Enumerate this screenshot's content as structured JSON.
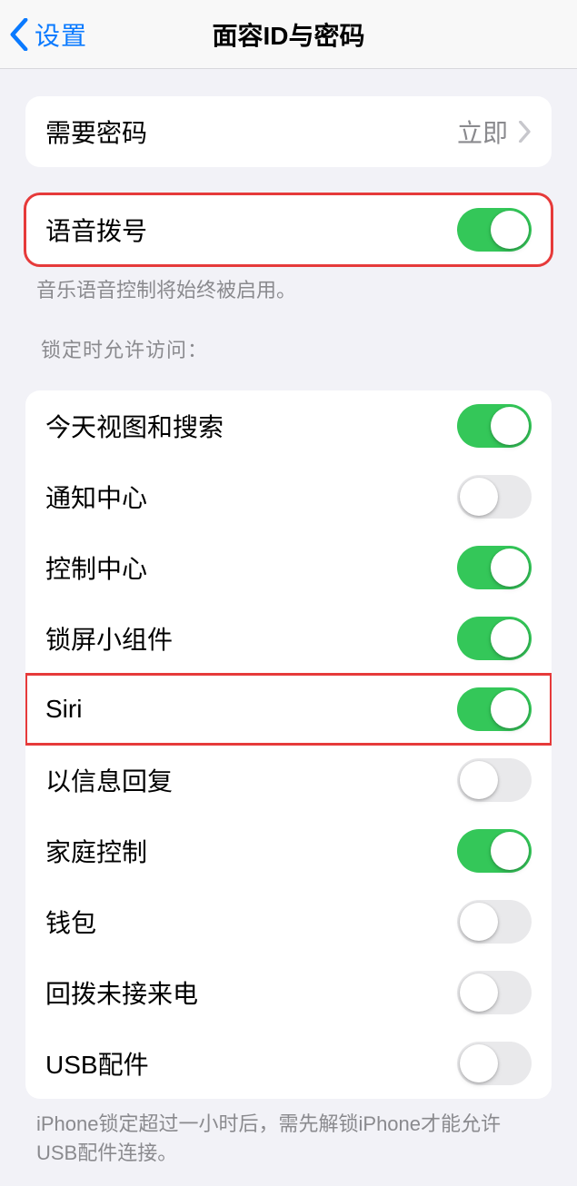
{
  "nav": {
    "back_label": "设置",
    "title": "面容ID与密码"
  },
  "require_passcode": {
    "label": "需要密码",
    "value": "立即"
  },
  "voice_dial": {
    "label": "语音拨号",
    "enabled": true,
    "footer": "音乐语音控制将始终被启用。"
  },
  "lock_section": {
    "header": "锁定时允许访问：",
    "items": [
      {
        "key": "today",
        "label": "今天视图和搜索",
        "enabled": true,
        "highlight": false
      },
      {
        "key": "notification",
        "label": "通知中心",
        "enabled": false,
        "highlight": false
      },
      {
        "key": "control",
        "label": "控制中心",
        "enabled": true,
        "highlight": false
      },
      {
        "key": "widgets",
        "label": "锁屏小组件",
        "enabled": true,
        "highlight": false
      },
      {
        "key": "siri",
        "label": "Siri",
        "enabled": true,
        "highlight": true
      },
      {
        "key": "reply",
        "label": "以信息回复",
        "enabled": false,
        "highlight": false
      },
      {
        "key": "home",
        "label": "家庭控制",
        "enabled": true,
        "highlight": false
      },
      {
        "key": "wallet",
        "label": "钱包",
        "enabled": false,
        "highlight": false
      },
      {
        "key": "callback",
        "label": "回拨未接来电",
        "enabled": false,
        "highlight": false
      },
      {
        "key": "usb",
        "label": "USB配件",
        "enabled": false,
        "highlight": false
      }
    ],
    "footer": "iPhone锁定超过一小时后，需先解锁iPhone才能允许USB配件连接。"
  },
  "colors": {
    "accent_blue": "#0a7aff",
    "switch_on": "#34c759",
    "switch_off": "#e9e9eb",
    "highlight_red": "#e63a3a"
  }
}
